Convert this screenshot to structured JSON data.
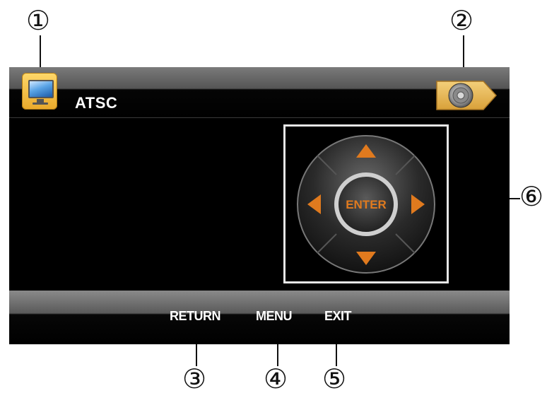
{
  "callouts": [
    "①",
    "②",
    "③",
    "④",
    "⑤",
    "⑥"
  ],
  "header": {
    "source_label": "ATSC"
  },
  "dpad": {
    "center_label": "ENTER"
  },
  "footer": {
    "return_label": "RETURN",
    "menu_label": "MENU",
    "exit_label": "EXIT"
  },
  "colors": {
    "accent": "#e07a1e",
    "icon_gold": "#f0b43c",
    "screen_bg": "#000000"
  },
  "icons": {
    "source": "tv-monitor-icon",
    "audio": "speaker-icon"
  }
}
